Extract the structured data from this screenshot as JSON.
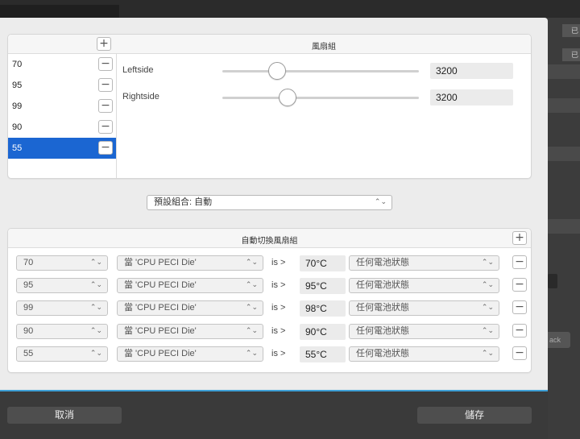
{
  "background": {
    "badges": [
      "已",
      "已"
    ],
    "ghost_text": "ack"
  },
  "fan_groups": {
    "title": "風扇組",
    "items": [
      {
        "label": "70",
        "selected": false
      },
      {
        "label": "95",
        "selected": false
      },
      {
        "label": "99",
        "selected": false
      },
      {
        "label": "90",
        "selected": false
      },
      {
        "label": "55",
        "selected": true
      }
    ],
    "fans": [
      {
        "name": "Leftside",
        "value": "3200",
        "slider_fraction": 0.28
      },
      {
        "name": "Rightside",
        "value": "3200",
        "slider_fraction": 0.33
      }
    ],
    "add_icon": "plus-icon",
    "remove_icon": "minus-icon"
  },
  "preset": {
    "label": "預設組合: 自動"
  },
  "auto_switch": {
    "title": "自動切換風扇組",
    "add_icon": "plus-icon",
    "is_text": "is >",
    "rules": [
      {
        "group": "70",
        "sensor": "當 'CPU PECI Die'",
        "temp": "70°C",
        "battery": "任何電池狀態"
      },
      {
        "group": "95",
        "sensor": "當 'CPU PECI Die'",
        "temp": "95°C",
        "battery": "任何電池狀態"
      },
      {
        "group": "99",
        "sensor": "當 'CPU PECI Die'",
        "temp": "98°C",
        "battery": "任何電池狀態"
      },
      {
        "group": "90",
        "sensor": "當 'CPU PECI Die'",
        "temp": "90°C",
        "battery": "任何電池狀態"
      },
      {
        "group": "55",
        "sensor": "當 'CPU PECI Die'",
        "temp": "55°C",
        "battery": "任何電池狀態"
      }
    ]
  },
  "footer": {
    "cancel_label": "取消",
    "save_label": "儲存"
  },
  "colors": {
    "selection": "#1b66d2",
    "accent_line": "#3ea0d6"
  }
}
